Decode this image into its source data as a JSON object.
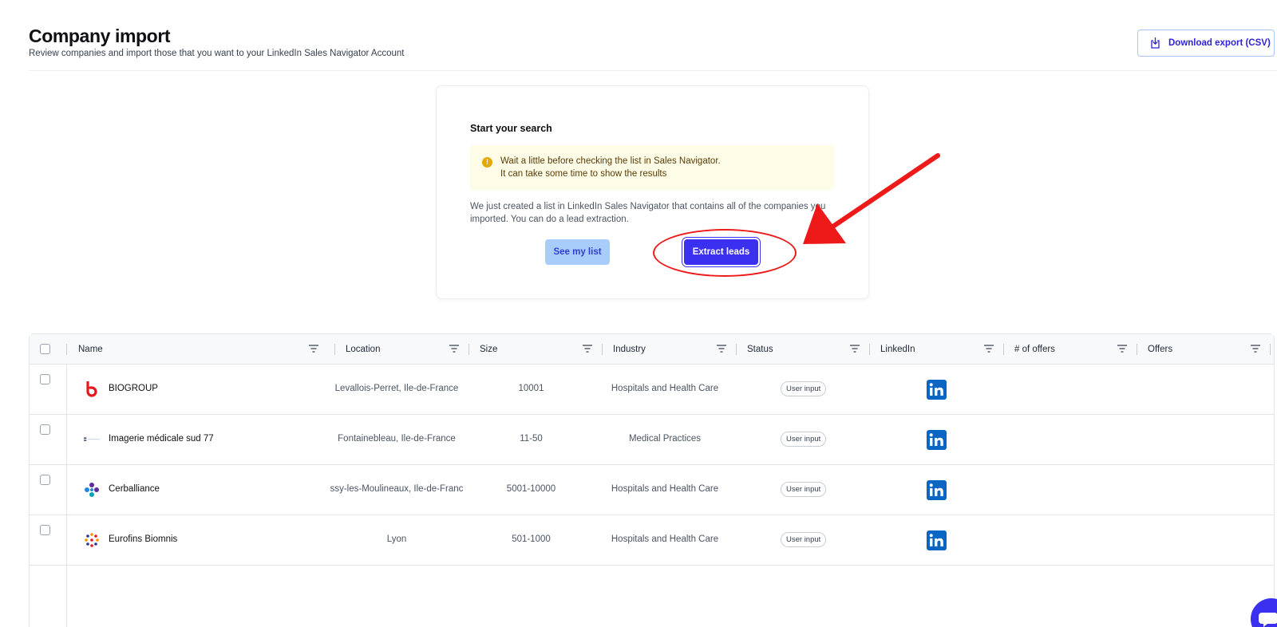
{
  "header": {
    "title": "Company import",
    "subtitle": "Review companies and import those that you want to your LinkedIn Sales Navigator Account",
    "download_label": "Download export (CSV)"
  },
  "search_card": {
    "title": "Start your search",
    "warning_line1": "Wait a little before checking the list in Sales Navigator.",
    "warning_line2": "It can take some time to show the results",
    "info_line1": "We just created a list in LinkedIn Sales Navigator that contains all of the companies you",
    "info_line2": "imported. You can do a lead extraction.",
    "see_list_label": "See my list",
    "extract_label": "Extract leads"
  },
  "table": {
    "columns": [
      "Name",
      "Location",
      "Size",
      "Industry",
      "Status",
      "LinkedIn",
      "# of offers",
      "Offers"
    ],
    "rows": [
      {
        "name": "BIOGROUP",
        "location": "Levallois-Perret, Île-de-France",
        "size": "10001",
        "industry": "Hospitals and Health Care",
        "status": "User input",
        "logo": "biogroup-logo"
      },
      {
        "name": "Imagerie médicale sud 77",
        "location": "Fontainebleau, Île-de-France",
        "size": "11-50",
        "industry": "Medical Practices",
        "status": "User input",
        "logo": "imagerie-logo"
      },
      {
        "name": "Cerballiance",
        "location": "ssy-les-Moulineaux, Île-de-Franc",
        "size": "5001-10000",
        "industry": "Hospitals and Health Care",
        "status": "User input",
        "logo": "cerballiance-logo"
      },
      {
        "name": "Eurofins Biomnis",
        "location": "Lyon",
        "size": "501-1000",
        "industry": "Hospitals and Health Care",
        "status": "User input",
        "logo": "eurofins-logo"
      }
    ]
  },
  "icons": {
    "download": "download-icon",
    "warning": "warning-icon",
    "filter": "filter-icon",
    "linkedin": "linkedin-icon",
    "chat": "chat-icon"
  },
  "colors": {
    "primary": "#3b2ff0",
    "annotation": "#ee1a1a",
    "linkedin": "#0a66c2",
    "warning_bg": "#fdfde7"
  }
}
